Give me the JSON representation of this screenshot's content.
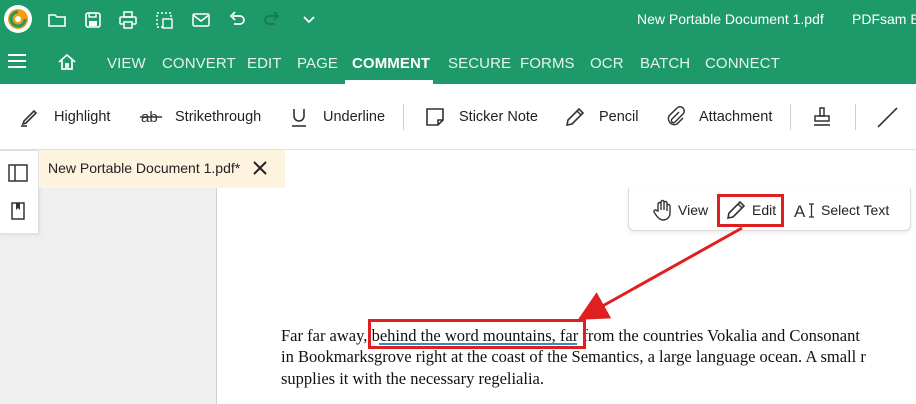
{
  "window": {
    "document_title": "New Portable Document 1.pdf",
    "app_title": "PDFsam En"
  },
  "quick_access": {
    "icons": [
      "pdfsam-logo-icon",
      "open-folder-icon",
      "save-icon",
      "print-icon",
      "scan-icon",
      "email-icon",
      "undo-icon",
      "redo-icon",
      "customize-chevron-icon"
    ]
  },
  "menu": {
    "tabs": [
      "VIEW",
      "CONVERT",
      "EDIT",
      "PAGE",
      "COMMENT",
      "SECURE",
      "FORMS",
      "OCR",
      "BATCH",
      "CONNECT"
    ],
    "active_tab": "COMMENT"
  },
  "toolbar": {
    "highlight": "Highlight",
    "strikethrough": "Strikethrough",
    "underline": "Underline",
    "sticker_note": "Sticker Note",
    "pencil": "Pencil",
    "attachment": "Attachment"
  },
  "document_tab": {
    "name": "New Portable Document 1.pdf*"
  },
  "mode_bar": {
    "view": "View",
    "edit": "Edit",
    "select_text": "Select Text"
  },
  "page": {
    "line1_before": "Far far away,",
    "line1_highlight": "behind the word mountains,",
    "line1_after": "far from the countries Vokalia and Consonant",
    "line2": "in Bookmarksgrove right at the coast of the Semantics, a large language ocean. A small r",
    "line3": "supplies it with the necessary regelialia."
  },
  "colors": {
    "brand_green": "#1e9a6a",
    "annotation_red": "#e02020",
    "underline_blue": "#2a8fd6",
    "tab_background": "#fdf3de"
  }
}
